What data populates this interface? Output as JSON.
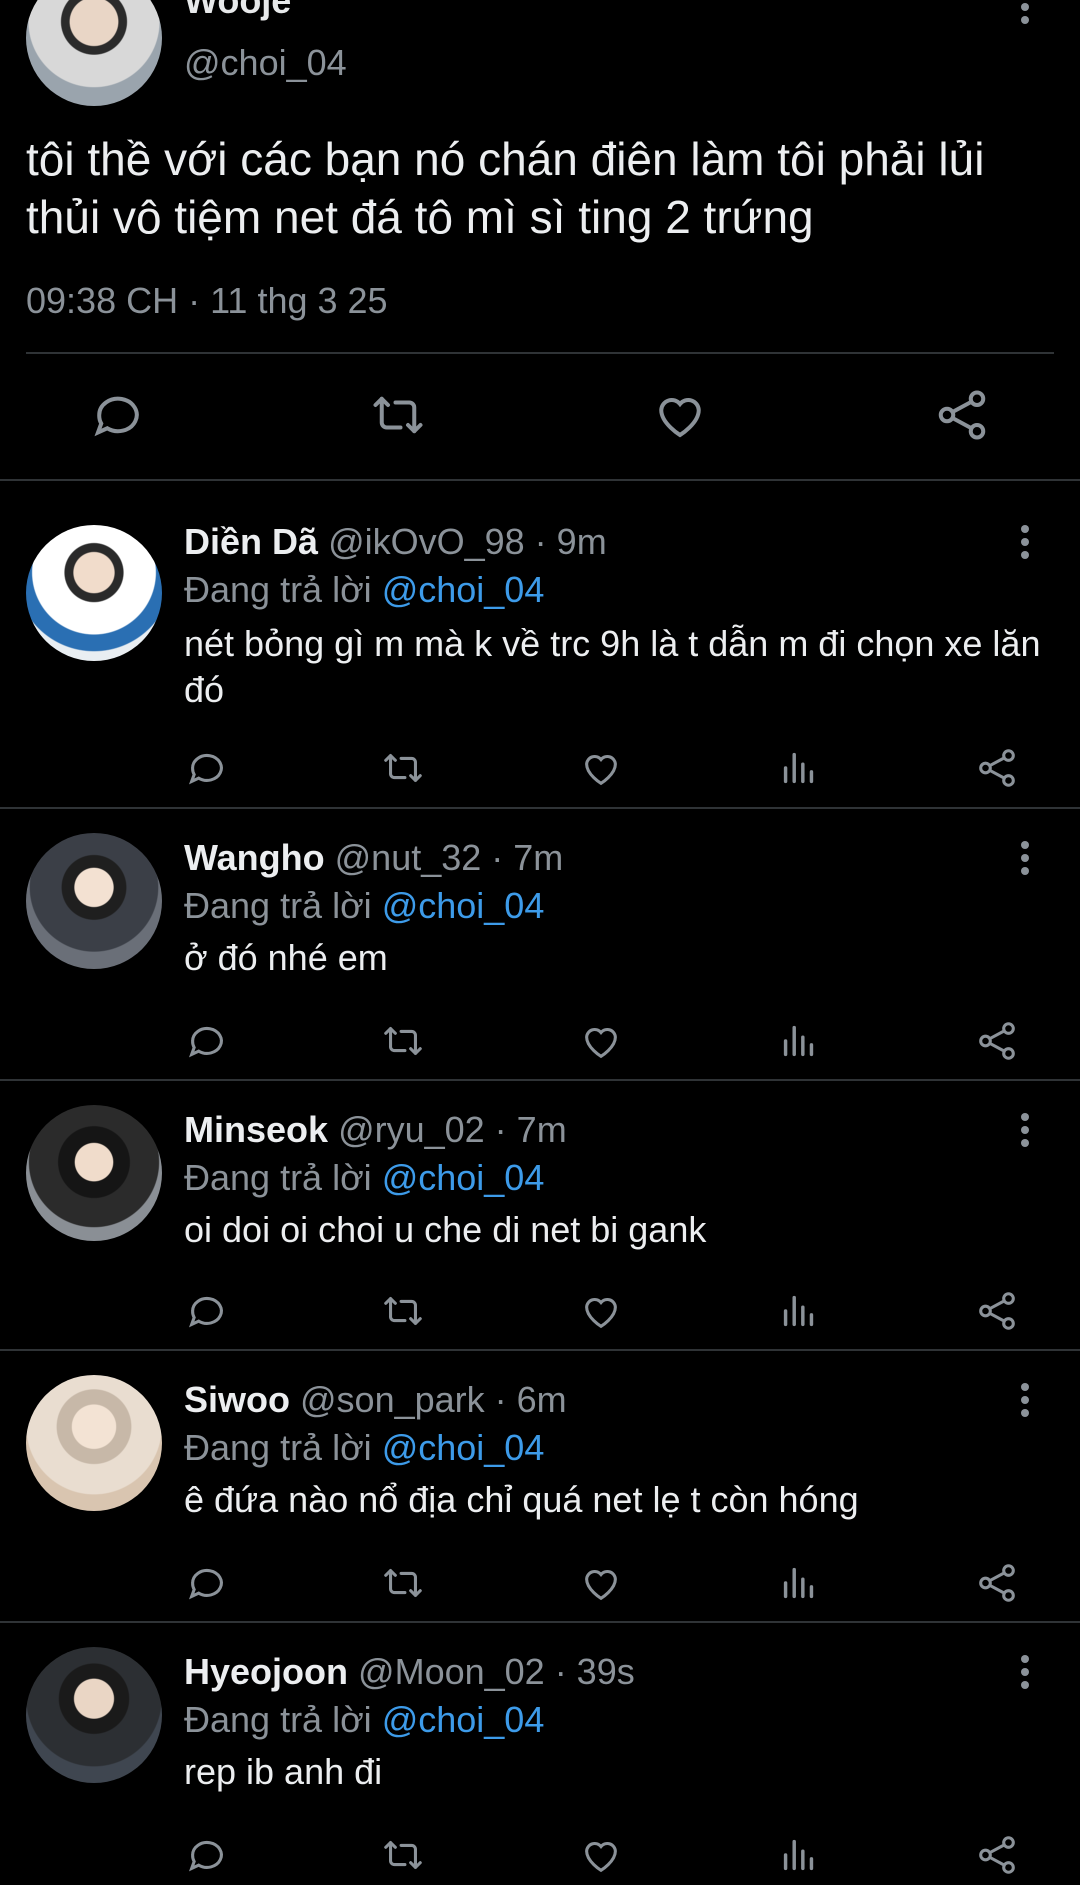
{
  "main_tweet": {
    "name": "Wooje",
    "handle": "@choi_04",
    "text": "tôi thề với các bạn nó chán điên làm tôi phải lủi thủi vô tiệm net đá tô mì sì ting 2 trứng",
    "timestamp": "09:38 CH · 11 thg 3 25",
    "actions": [
      "reply-icon",
      "retweet-icon",
      "like-icon",
      "share-icon"
    ]
  },
  "replies": [
    {
      "name": "Diền Dã",
      "meta": "@ikOvO_98 · 9m",
      "replying_label": "Đang trả lời",
      "replying_to": "@choi_04",
      "text": "nét bỏng gì m mà k về trc 9h là t dẫn m đi chọn xe lăn đó"
    },
    {
      "name": "Wangho",
      "meta": "@nut_32 · 7m",
      "replying_label": "Đang trả lời",
      "replying_to": "@choi_04",
      "text": "ở đó nhé em"
    },
    {
      "name": "Minseok",
      "meta": "@ryu_02 · 7m",
      "replying_label": "Đang trả lời",
      "replying_to": "@choi_04",
      "text": "oi doi oi choi u che di net bi gank"
    },
    {
      "name": "Siwoo",
      "meta": "@son_park · 6m",
      "replying_label": "Đang trả lời",
      "replying_to": "@choi_04",
      "text": "ê đứa nào nổ địa chỉ quá net lẹ t còn hóng"
    },
    {
      "name": "Hyeojoon",
      "meta": "@Moon_02 · 39s",
      "replying_label": "Đang trả lời",
      "replying_to": "@choi_04",
      "text": "rep ib anh đi"
    }
  ],
  "reply_actions": [
    "reply-icon",
    "retweet-icon",
    "like-icon",
    "views-icon",
    "share-icon"
  ],
  "colors": {
    "background": "#000000",
    "text": "#e7e9ea",
    "muted": "#8b9299",
    "link": "#3d9be9",
    "divider": "#2f3336"
  }
}
